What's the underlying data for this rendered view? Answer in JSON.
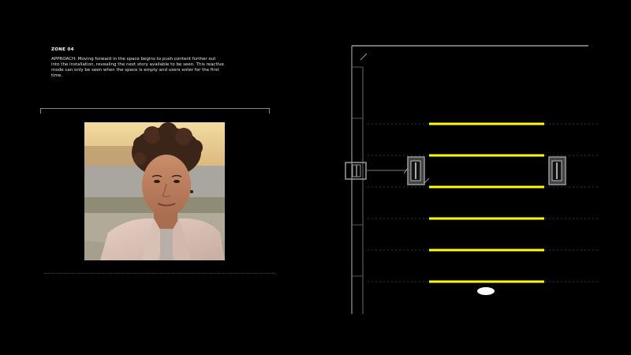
{
  "zone": {
    "label": "ZONE 04",
    "description": "APPROACH: Moving forward in the space begins to push content further out into the installation, revealing the next story available to be seen. This reactive mode can only be seen when the space is empty and users enter for the first time."
  },
  "photo": {
    "subject": "portrait of a woman with short curly hair"
  },
  "colors": {
    "background": "#000000",
    "content_line": "#ffff00",
    "structure": "#9a9a9a",
    "grid": "#333333"
  },
  "plan": {
    "content_line_count": 6,
    "sensor_count": 3,
    "visitor_marker": "white-ellipse"
  }
}
